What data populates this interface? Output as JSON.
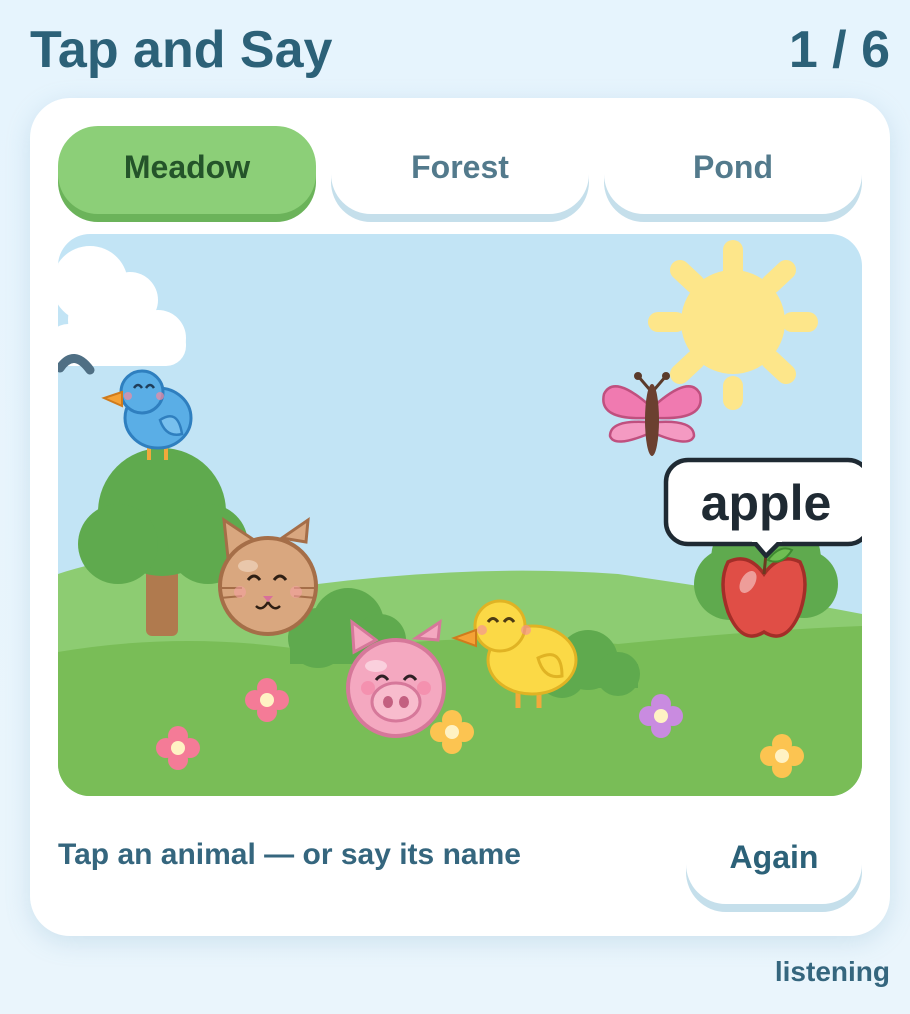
{
  "header": {
    "title": "Tap and Say",
    "counter": "1 / 6"
  },
  "tabs": [
    {
      "label": "Meadow",
      "active": true
    },
    {
      "label": "Forest",
      "active": false
    },
    {
      "label": "Pond",
      "active": false
    }
  ],
  "scene": {
    "speech_bubble": "apple",
    "objects": [
      "bird-icon",
      "butterfly-icon",
      "cat-icon",
      "pig-icon",
      "chick-icon",
      "apple-icon",
      "sun-icon",
      "cloud-icon",
      "tree-icon",
      "flower-icon"
    ]
  },
  "footer": {
    "hint": "Tap an animal — or say its name",
    "again_label": "Again"
  },
  "status": "listening",
  "colors": {
    "accent_green": "#8ccf78",
    "sky": "#c2e4f5",
    "grass": "#8dcc72",
    "text": "#2c6178"
  }
}
